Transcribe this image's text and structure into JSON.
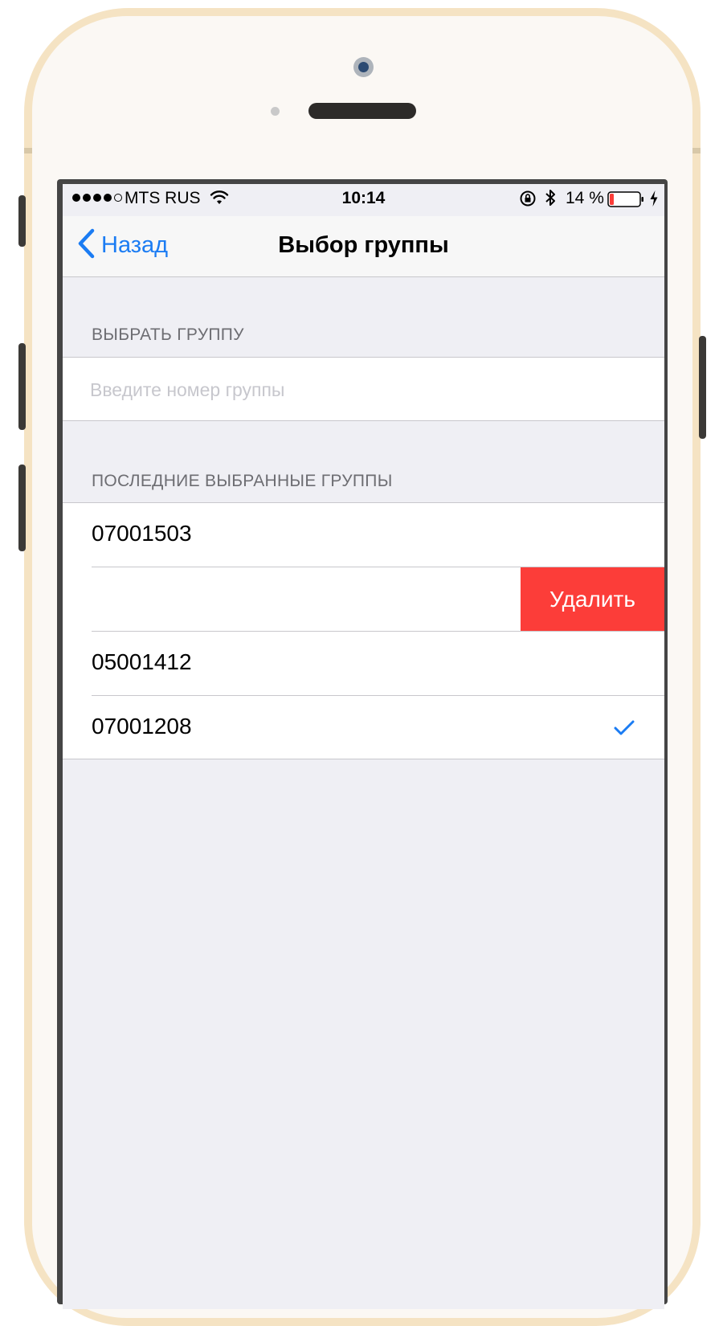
{
  "status_bar": {
    "carrier": "MTS RUS",
    "time": "10:14",
    "battery_percent": "14 %",
    "battery_level": 0.14,
    "signal_bars_filled": 4,
    "signal_bars_total": 5,
    "icons": [
      "wifi-icon",
      "rotation-lock-icon",
      "bluetooth-icon",
      "battery-icon",
      "charging-bolt-icon"
    ]
  },
  "nav": {
    "back_label": "Назад",
    "title": "Выбор группы"
  },
  "select_section": {
    "header": "ВЫБРАТЬ ГРУППУ",
    "input_value": "",
    "input_placeholder": "Введите номер группы"
  },
  "recent_section": {
    "header": "ПОСЛЕДНИЕ ВЫБРАННЫЕ ГРУППЫ",
    "items": [
      {
        "label": "07001503",
        "selected": false
      },
      {
        "label": "",
        "selected": false,
        "swiped": true,
        "delete_label": "Удалить"
      },
      {
        "label": "05001412",
        "selected": false
      },
      {
        "label": "07001208",
        "selected": true
      }
    ]
  },
  "colors": {
    "accent": "#1b7cf3",
    "delete": "#fc3d39",
    "background": "#efeff4",
    "frame": "#f5e3c3"
  }
}
